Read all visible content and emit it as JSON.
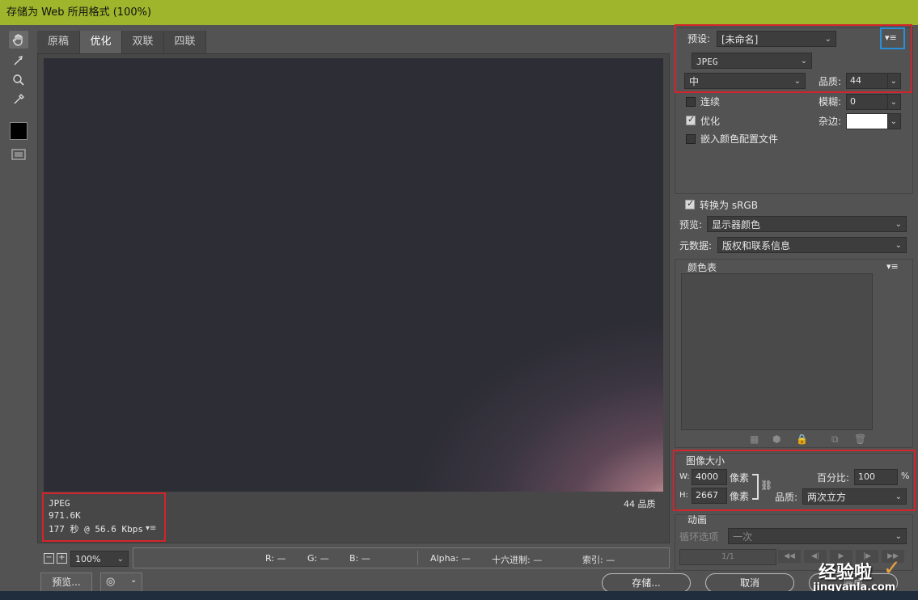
{
  "window": {
    "title": "存储为 Web 所用格式 (100%)"
  },
  "tools": [
    {
      "icon": "hand-icon",
      "label": "✋"
    },
    {
      "icon": "slice-select-icon",
      "label": "➶"
    },
    {
      "icon": "zoom-icon",
      "label": "🔍"
    },
    {
      "icon": "eyedropper-icon",
      "label": "✎"
    }
  ],
  "tabs": [
    {
      "label": "原稿"
    },
    {
      "label": "优化"
    },
    {
      "label": "双联"
    },
    {
      "label": "四联"
    }
  ],
  "preview_info": {
    "format": "JPEG",
    "size": "971.6K",
    "time": "177 秒 @ 56.6 Kbps",
    "quality_label": "44 品质"
  },
  "settings": {
    "preset_label": "预设:",
    "preset_value": "[未命名]",
    "format_value": "JPEG",
    "quality_level": "中",
    "quality_label": "品质:",
    "quality_value": "44",
    "progressive_label": "连续",
    "blur_label": "模糊:",
    "blur_value": "0",
    "optimized_label": "优化",
    "matte_label": "杂边:",
    "embed_profile_label": "嵌入颜色配置文件",
    "convert_srgb_label": "转换为 sRGB",
    "preview_label": "预览:",
    "preview_value": "显示器颜色",
    "metadata_label": "元数据:",
    "metadata_value": "版权和联系信息"
  },
  "color_table": {
    "title": "颜色表"
  },
  "image_size": {
    "title": "图像大小",
    "w_label": "W:",
    "w_value": "4000",
    "h_label": "H:",
    "h_value": "2667",
    "unit": "像素",
    "percent_label": "百分比:",
    "percent_value": "100",
    "percent_unit": "%",
    "quality_label": "品质:",
    "quality_value": "两次立方"
  },
  "animation": {
    "title": "动画",
    "loop_label": "循环选项",
    "loop_value": "一次",
    "frame_counter": "1/1"
  },
  "status": {
    "zoom": "100%",
    "r": "R: —",
    "g": "G: —",
    "b": "B: —",
    "alpha": "Alpha: —",
    "hex": "十六进制: —",
    "index": "索引: —"
  },
  "buttons": {
    "preview": "预览...",
    "save": "存储...",
    "cancel": "取消",
    "done": "完成"
  },
  "watermark": {
    "text": "经验啦",
    "url": "jingyanla.com"
  },
  "colors": {
    "title_bar": "#9fb52c",
    "highlight_red": "#d4242b",
    "highlight_blue": "#2a8fd6"
  }
}
